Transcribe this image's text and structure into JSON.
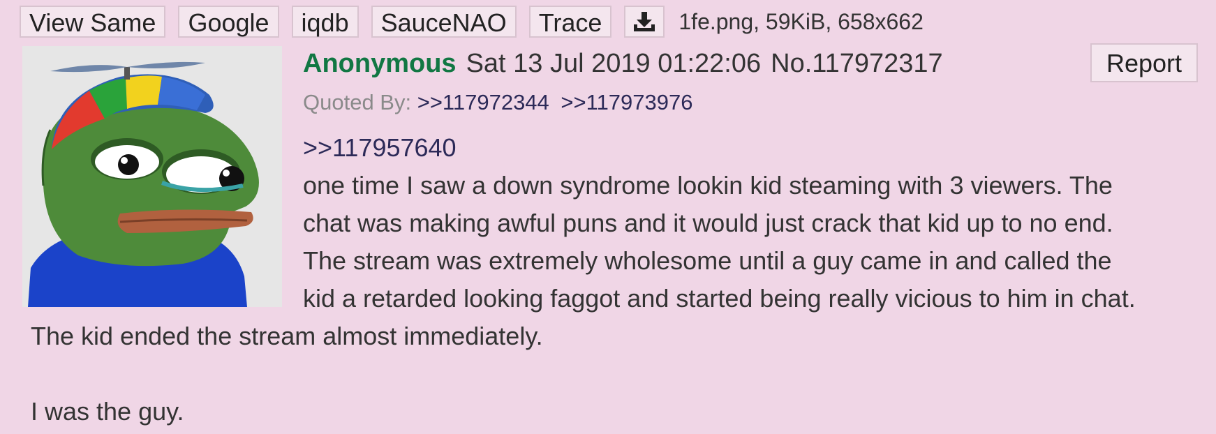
{
  "toolbar": {
    "buttons": [
      "View Same",
      "Google",
      "iqdb",
      "SauceNAO",
      "Trace"
    ],
    "download_icon": "download-icon",
    "file_info": "1fe.png, 59KiB, 658x662"
  },
  "post": {
    "name": "Anonymous",
    "date": "Sat 13 Jul 2019 01:22:06",
    "number": "No.117972317",
    "report_label": "Report",
    "quoted_by_label": "Quoted By:",
    "quoted_by": [
      ">>117972344",
      ">>117973976"
    ],
    "reply_to": ">>117957640",
    "lines": [
      "one time I saw a down syndrome lookin kid steaming with 3 viewers. The",
      "chat was making awful puns and it would just crack that kid up to no end.",
      "The stream was extremely wholesome until a guy came in and called the",
      "kid a retarded looking faggot and started being really vicious to him in chat.",
      "The kid ended the stream almost immediately.",
      "I was the guy."
    ]
  },
  "colors": {
    "background": "#f0d6e6",
    "name": "#117743",
    "link": "#2c2a58"
  }
}
